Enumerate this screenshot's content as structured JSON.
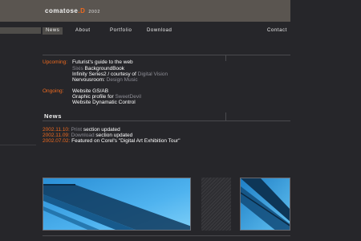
{
  "header": {
    "brand_name": "comatose",
    "brand_dot": ".D",
    "brand_year": "2002"
  },
  "nav": {
    "items": [
      {
        "label": "News"
      },
      {
        "label": "About"
      },
      {
        "label": "Portfolio"
      },
      {
        "label": "Download"
      },
      {
        "label": "Contact"
      }
    ]
  },
  "upcoming": {
    "label": "Upcoming:",
    "lines": [
      {
        "pre": "",
        "pre_gray": "",
        "main": "Futurist's guide to the web",
        "post_gray": ""
      },
      {
        "pre": "",
        "pre_gray": "Sixis ",
        "main": "BackgroundBook",
        "post_gray": ""
      },
      {
        "pre": "",
        "pre_gray": "",
        "main": "Infinity Series2 / courtesy of ",
        "post_gray": "Digital Vision"
      },
      {
        "pre": "",
        "pre_gray": "",
        "main": "Nervousroom: ",
        "post_gray": "Design Music"
      }
    ]
  },
  "ongoing": {
    "label": "Ongoing:",
    "lines": [
      {
        "main": "Website GS/AB",
        "post_gray": ""
      },
      {
        "main": "Graphic profile for ",
        "post_gray": "SweetDevil"
      },
      {
        "main": "Website Dynamatic Control",
        "post_gray": ""
      }
    ]
  },
  "news": {
    "title": "News",
    "items": [
      {
        "date": "2002.11.10:",
        "gray": " Print",
        "text": " section updated"
      },
      {
        "date": "2002.11.09:",
        "gray": " Download",
        "text": " section updated"
      },
      {
        "date": "2002.07.02:",
        "gray": "",
        "text": " Featured on Corel's \"Digital Art Exhibition Tour\""
      }
    ]
  },
  "colors": {
    "background": "#26262a",
    "header": "#5a5550",
    "accent": "#ef6a1f",
    "muted": "#8e8e96"
  }
}
